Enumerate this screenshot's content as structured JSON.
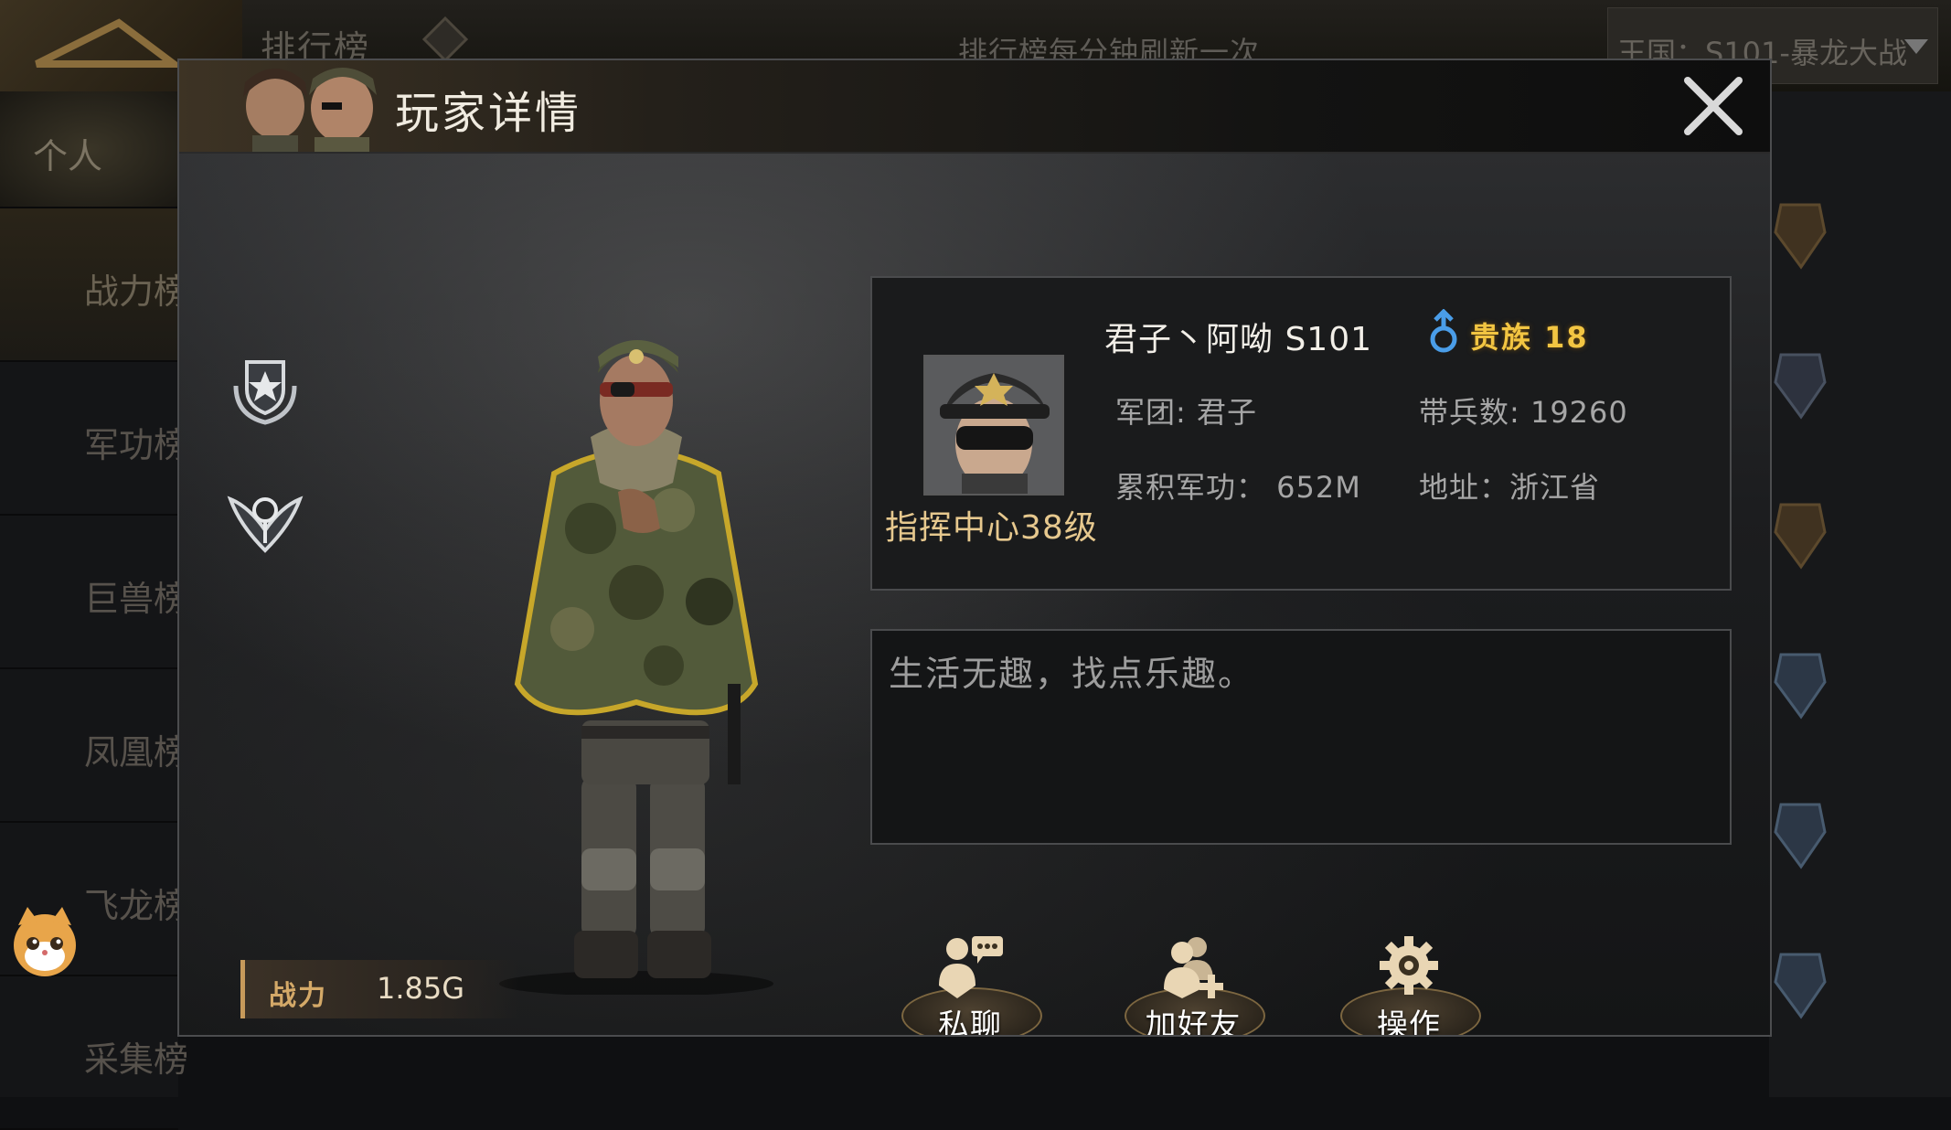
{
  "background": {
    "header_title": "排行榜",
    "refresh_notice": "排行榜每分钟刷新一次",
    "kingdom_selector": "王国：S101-暴龙大战",
    "sidebar_tabs": [
      "个人",
      "战力榜",
      "军功榜",
      "巨兽榜",
      "凤凰榜",
      "飞龙榜",
      "采集榜"
    ]
  },
  "modal": {
    "title": "玩家详情",
    "power": {
      "label": "战力",
      "value": "1.85G"
    },
    "player": {
      "name": "君子丶阿呦 S101",
      "noble": "贵族 18",
      "level": "指挥中心38级",
      "legion": "军团: 君子",
      "troops": "带兵数: 19260",
      "merit": "累积军功： 652M",
      "address": "地址：浙江省"
    },
    "signature": "生活无趣，找点乐趣。",
    "actions": [
      {
        "label": "私聊",
        "icon": "private-chat-icon"
      },
      {
        "label": "加好友",
        "icon": "add-friend-icon"
      },
      {
        "label": "操作",
        "icon": "gear-icon"
      }
    ]
  },
  "colors": {
    "gold": "#e6c88e",
    "noble": "#f2c542",
    "gender_blue": "#4a9de8"
  }
}
